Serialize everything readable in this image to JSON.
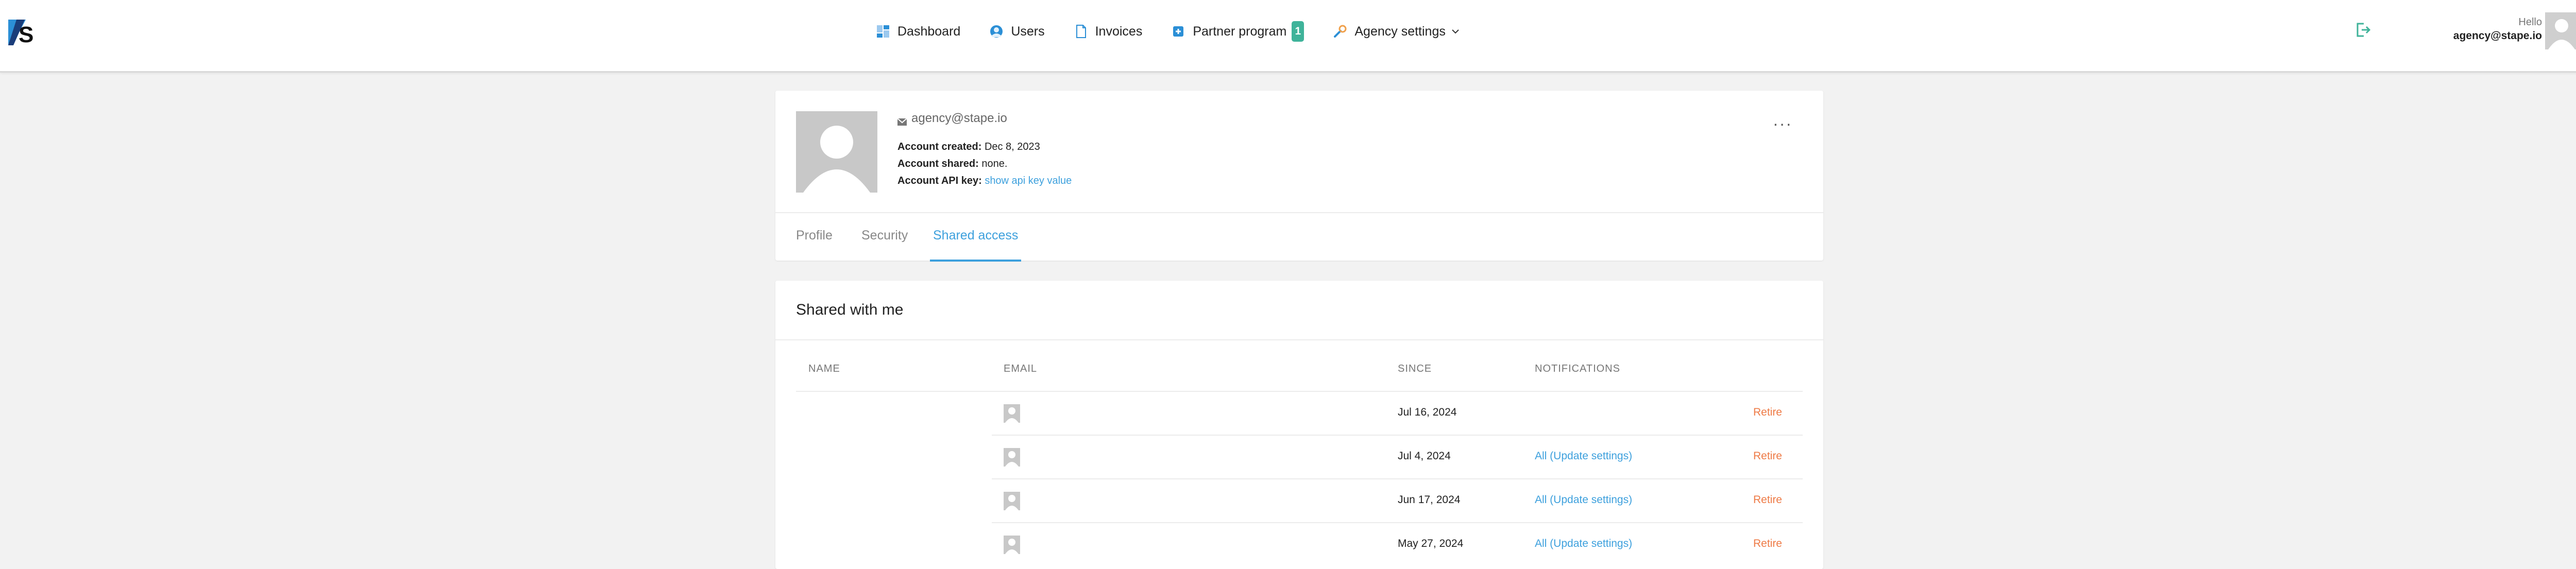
{
  "header": {
    "logo_icon": "stape-logo-icon",
    "nav": [
      {
        "label": "Dashboard",
        "icon": "dashboard-icon"
      },
      {
        "label": "Users",
        "icon": "users-icon"
      },
      {
        "label": "Invoices",
        "icon": "invoice-icon"
      },
      {
        "label": "Partner program",
        "icon": "partner-icon",
        "badge": "1"
      },
      {
        "label": "Agency settings",
        "icon": "wrench-icon",
        "dropdown": true
      }
    ],
    "logout_icon": "logout-icon",
    "hello": "Hello",
    "user_email": "agency@stape.io"
  },
  "profile": {
    "email": "agency@stape.io",
    "created_label": "Account created:",
    "created_value": "Dec 8, 2023",
    "shared_label": "Account shared:",
    "shared_value": "none.",
    "api_label": "Account API key:",
    "api_link": "show api key value",
    "more": "···",
    "tabs": [
      "Profile",
      "Security",
      "Shared access"
    ],
    "active_tab": "Shared access"
  },
  "shared": {
    "title": "Shared with me",
    "columns": [
      "NAME",
      "EMAIL",
      "SINCE",
      "NOTIFICATIONS"
    ],
    "rows": [
      {
        "since": "Jul 16, 2024",
        "notifications": "",
        "action": "Retire"
      },
      {
        "since": "Jul 4, 2024",
        "notifications": "All (Update settings)",
        "action": "Retire"
      },
      {
        "since": "Jun 17, 2024",
        "notifications": "All (Update settings)",
        "action": "Retire"
      },
      {
        "since": "May 27, 2024",
        "notifications": "All (Update settings)",
        "action": "Retire"
      }
    ]
  },
  "colors": {
    "accent": "#3da0dd",
    "badge": "#3fb39a",
    "danger": "#ee7a45",
    "logout": "#3fb39a"
  }
}
